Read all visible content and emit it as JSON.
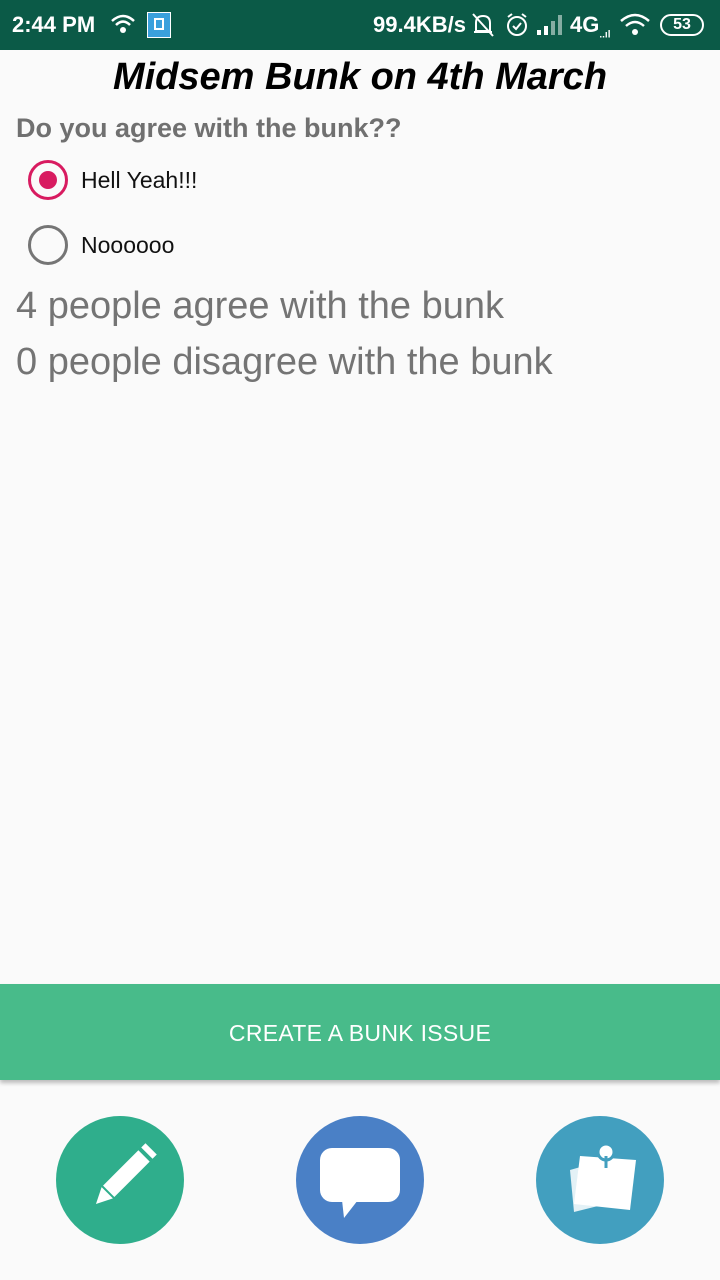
{
  "status_bar": {
    "time": "2:44 PM",
    "network_speed": "99.4KB/s",
    "network_type": "4G",
    "network_type_sub": "..ıl",
    "battery": "53",
    "icons": [
      "wifi-icon",
      "sim-icon",
      "bell-off-icon",
      "alarm-icon",
      "signal-icon",
      "wifi-icon",
      "battery-icon"
    ]
  },
  "poll": {
    "title": "Midsem Bunk on 4th March",
    "question": "Do you agree with the bunk??",
    "options": [
      {
        "label": "Hell Yeah!!!",
        "selected": true
      },
      {
        "label": "Noooooo",
        "selected": false
      }
    ],
    "agree_text": "4 people agree with the bunk",
    "disagree_text": "0 people disagree with the bunk"
  },
  "actions": {
    "create_label": "CREATE A BUNK ISSUE"
  },
  "bottom_nav": {
    "items": [
      {
        "icon": "pencil-icon"
      },
      {
        "icon": "chat-icon"
      },
      {
        "icon": "notes-icon"
      }
    ]
  },
  "colors": {
    "status_bar": "#0b5a47",
    "accent": "#d81b60",
    "button": "#48bb8a"
  }
}
